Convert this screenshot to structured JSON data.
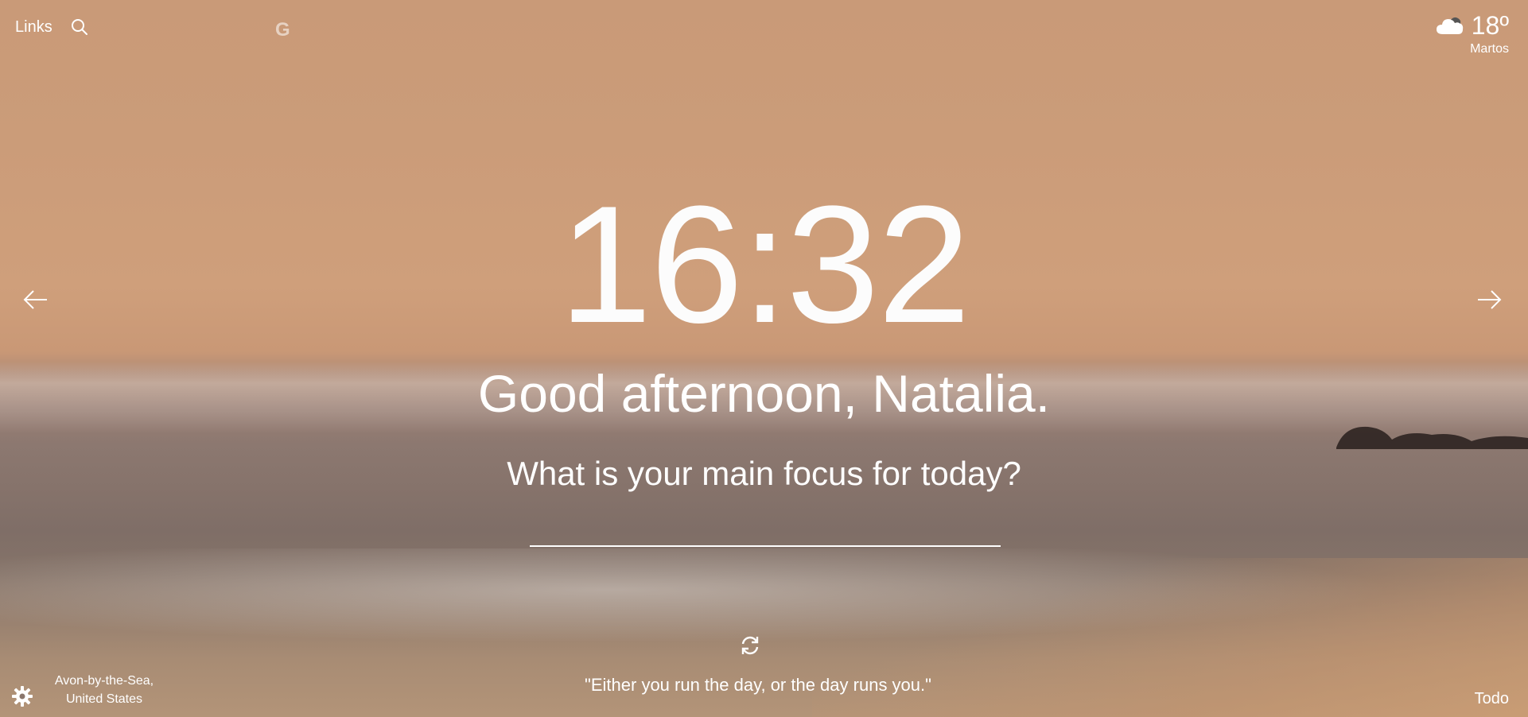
{
  "topbar": {
    "links_label": "Links",
    "search_icon": "search-icon",
    "google_icon": "google-icon",
    "google_glyph": "G"
  },
  "weather": {
    "icon": "cloud-icon",
    "temperature": "18º",
    "location": "Martos"
  },
  "clock": {
    "time": "16:32"
  },
  "greeting": {
    "text": "Good afternoon, Natalia."
  },
  "focus": {
    "question": "What is your main focus for today?",
    "input_value": "",
    "input_placeholder": ""
  },
  "navigation": {
    "prev_icon": "arrow-left-icon",
    "next_icon": "arrow-right-icon"
  },
  "quote": {
    "refresh_icon": "refresh-icon",
    "text": "\"Either you run the day, or the day runs you.\""
  },
  "footer": {
    "settings_icon": "gear-icon",
    "photo_location_line1": "Avon-by-the-Sea,",
    "photo_location_line2": "United States",
    "todo_label": "Todo"
  },
  "colors": {
    "text": "#ffffff",
    "sky": "#c99a78"
  }
}
